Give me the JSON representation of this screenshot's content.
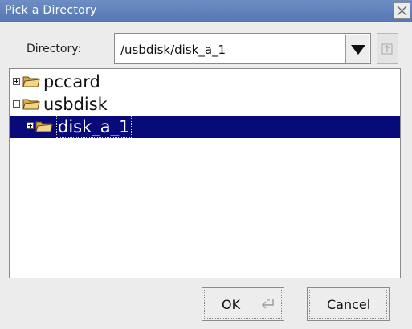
{
  "window": {
    "title": "Pick a Directory"
  },
  "directory": {
    "label": "Directory:",
    "value": "/usbdisk/disk_a_1"
  },
  "tree": {
    "nodes": [
      {
        "label": "pccard"
      },
      {
        "label": "usbdisk"
      },
      {
        "label": "disk_a_1"
      }
    ]
  },
  "buttons": {
    "ok": "OK",
    "cancel": "Cancel"
  }
}
